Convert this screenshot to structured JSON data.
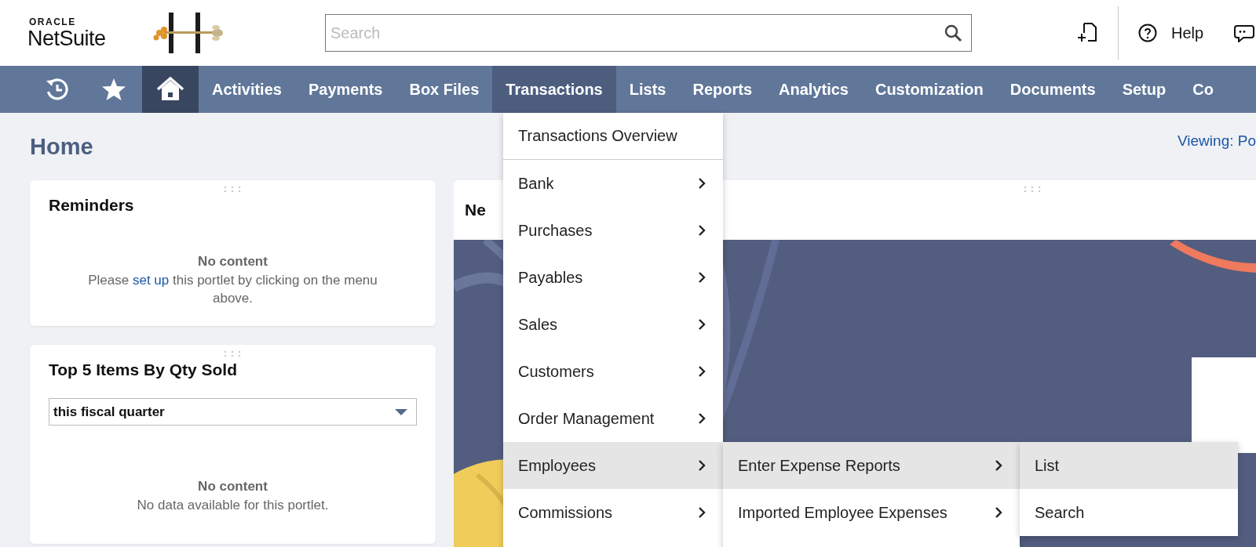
{
  "header": {
    "brand_top": "ORACLE",
    "brand": "NetSuite",
    "search": {
      "placeholder": "Search"
    },
    "help": "Help"
  },
  "nav": [
    {
      "kind": "history",
      "selected": false,
      "open": false
    },
    {
      "kind": "star",
      "selected": false,
      "open": false
    },
    {
      "kind": "home",
      "selected": true,
      "open": false
    },
    {
      "kind": "text",
      "label": "Activities",
      "selected": false,
      "open": false
    },
    {
      "kind": "text",
      "label": "Payments",
      "selected": false,
      "open": false
    },
    {
      "kind": "text",
      "label": "Box Files",
      "selected": false,
      "open": false
    },
    {
      "kind": "text",
      "label": "Transactions",
      "selected": false,
      "open": true
    },
    {
      "kind": "text",
      "label": "Lists",
      "selected": false,
      "open": false
    },
    {
      "kind": "text",
      "label": "Reports",
      "selected": false,
      "open": false
    },
    {
      "kind": "text",
      "label": "Analytics",
      "selected": false,
      "open": false
    },
    {
      "kind": "text",
      "label": "Customization",
      "selected": false,
      "open": false
    },
    {
      "kind": "text",
      "label": "Documents",
      "selected": false,
      "open": false
    },
    {
      "kind": "text",
      "label": "Setup",
      "selected": false,
      "open": false
    },
    {
      "kind": "text",
      "label": "Co",
      "selected": false,
      "open": false
    }
  ],
  "page": {
    "title": "Home",
    "viewing": "Viewing: Po"
  },
  "portlets": [
    {
      "title": "Reminders",
      "empty_title": "No content",
      "message_before": "Please ",
      "message_link": "set up",
      "message_after": " this portlet by clicking on the menu above."
    },
    {
      "title": "Top 5 Items By Qty Sold",
      "select": "this fiscal quarter",
      "empty_title": "No content",
      "message_before": "No data available for this portlet."
    }
  ],
  "news": {
    "title": "Ne"
  },
  "menu": [
    {
      "label": "Transactions Overview",
      "has_submenu": false,
      "selected": false
    },
    {
      "label": "Bank",
      "has_submenu": true,
      "selected": false
    },
    {
      "label": "Purchases",
      "has_submenu": true,
      "selected": false
    },
    {
      "label": "Payables",
      "has_submenu": true,
      "selected": false
    },
    {
      "label": "Sales",
      "has_submenu": true,
      "selected": false
    },
    {
      "label": "Customers",
      "has_submenu": true,
      "selected": false
    },
    {
      "label": "Order Management",
      "has_submenu": true,
      "selected": false
    },
    {
      "label": "Employees",
      "has_submenu": true,
      "selected": true
    },
    {
      "label": "Commissions",
      "has_submenu": true,
      "selected": false
    }
  ],
  "submenu": [
    {
      "label": "Enter Expense Reports",
      "has_submenu": true,
      "selected": true
    },
    {
      "label": "Imported Employee Expenses",
      "has_submenu": true,
      "selected": false
    }
  ],
  "submenu_2": [
    {
      "label": "List",
      "has_submenu": false,
      "selected": true
    },
    {
      "label": "Search",
      "has_submenu": false,
      "selected": false
    }
  ]
}
